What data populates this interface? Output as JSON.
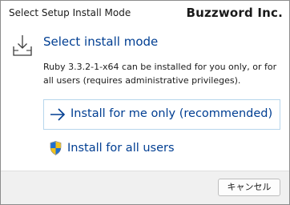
{
  "window": {
    "title": "Select Setup Install Mode",
    "brand": "Buzzword Inc."
  },
  "main": {
    "heading": "Select install mode",
    "description": "Ruby 3.3.2-1-x64 can be installed for you only, or for all users (requires administrative privileges).",
    "options": [
      {
        "label": "Install for me only (recommended)",
        "icon": "arrow-right-icon"
      },
      {
        "label": "Install for all users",
        "icon": "uac-shield-icon"
      }
    ]
  },
  "footer": {
    "cancel_label": "キャンセル"
  },
  "colors": {
    "link_blue": "#003e92",
    "primary_border": "#b7d6ec",
    "footer_bg": "#f0f0f0"
  }
}
